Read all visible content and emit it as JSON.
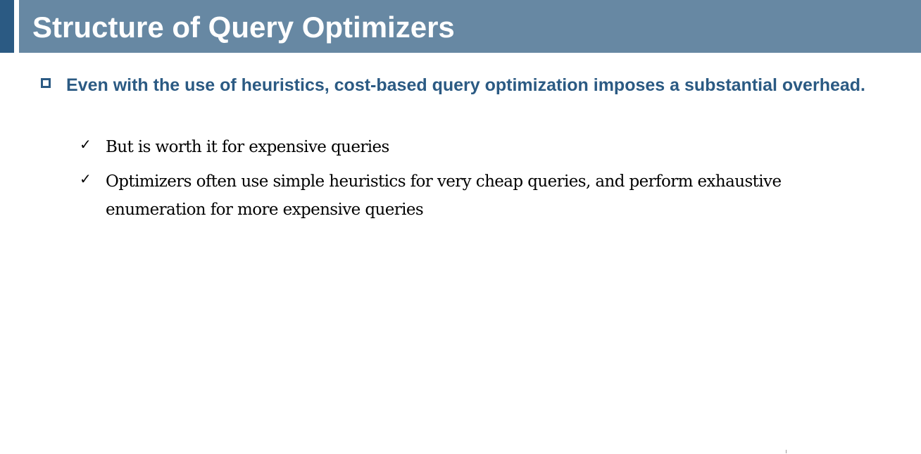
{
  "slide": {
    "title": "Structure of Query Optimizers",
    "bullets": [
      {
        "text": "Even with the use of heuristics, cost-based query optimization imposes a substantial overhead.",
        "icon": "square-bullet-icon",
        "sub_bullets": [
          {
            "text": "But is worth it for expensive queries",
            "icon": "checkmark-icon",
            "icon_glyph": "✓"
          },
          {
            "text": "Optimizers often use simple heuristics for very cheap queries, and perform exhaustive enumeration for more expensive queries",
            "icon": "checkmark-icon",
            "icon_glyph": "✓"
          }
        ]
      }
    ]
  },
  "colors": {
    "title_band": "#6788a3",
    "title_accent": "#2b5a83",
    "title_text": "#ffffff",
    "level1_text": "#2b5a83",
    "level2_text": "#000000"
  }
}
